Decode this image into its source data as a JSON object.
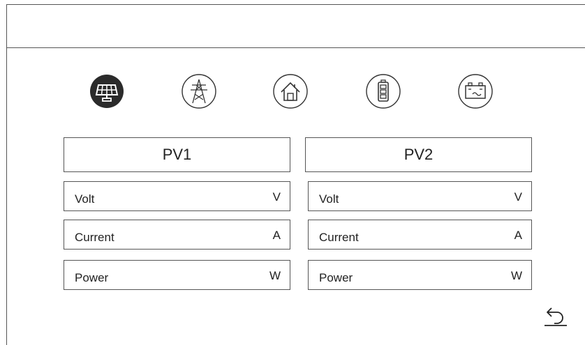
{
  "icons": [
    "solar-panel-icon",
    "grid-tower-icon",
    "home-icon",
    "battery-icon",
    "battery-inverter-icon"
  ],
  "active_icon": "solar-panel-icon",
  "pv1": {
    "title": "PV1",
    "rows": [
      {
        "label": "Volt",
        "unit": "V"
      },
      {
        "label": "Current",
        "unit": "A"
      },
      {
        "label": "Power",
        "unit": "W"
      }
    ]
  },
  "pv2": {
    "title": "PV2",
    "rows": [
      {
        "label": "Volt",
        "unit": "V"
      },
      {
        "label": "Current",
        "unit": "A"
      },
      {
        "label": "Power",
        "unit": "W"
      }
    ]
  },
  "colors": {
    "line": "#555555",
    "active_icon_fill": "#2b2b2b",
    "background": "#ffffff"
  }
}
